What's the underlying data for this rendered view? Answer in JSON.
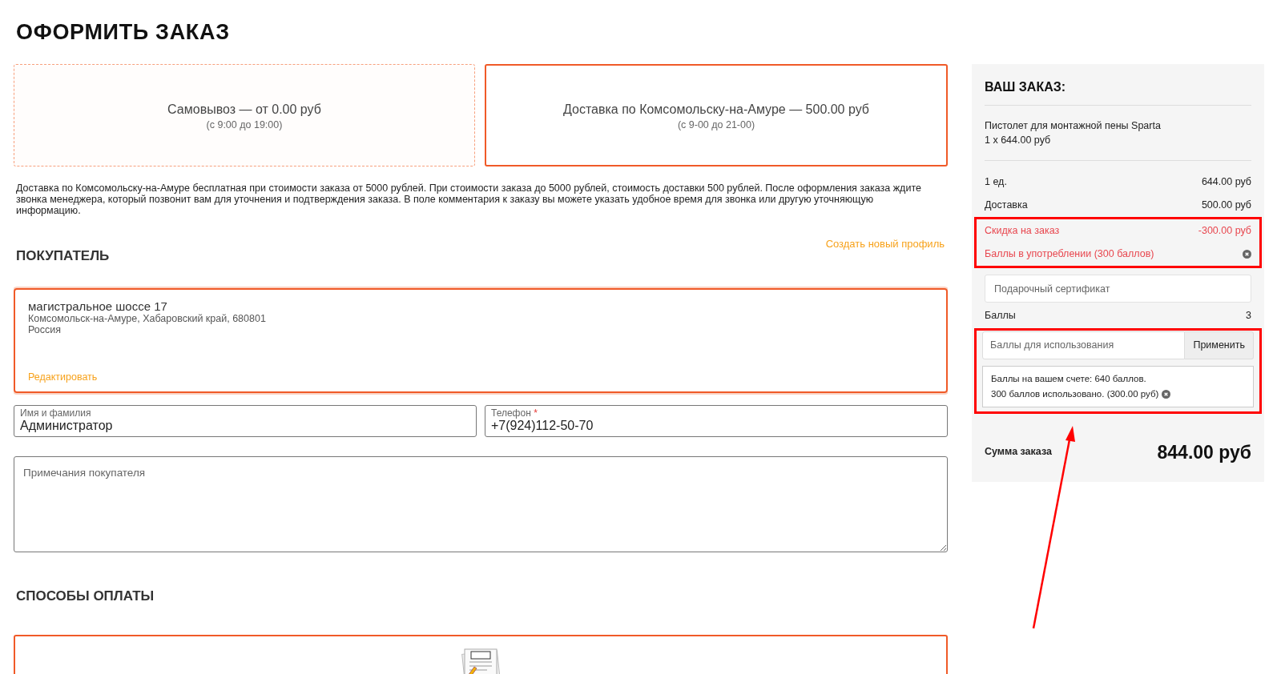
{
  "page_title": "ОФОРМИТЬ ЗАКАЗ",
  "delivery_options": [
    {
      "title": "Самовывоз — от 0.00 руб",
      "hours": "(с 9:00 до 19:00)",
      "selected": false
    },
    {
      "title": "Доставка по Комсомольску-на-Амуре — 500.00 руб",
      "hours": "(с 9-00 до 21-00)",
      "selected": true
    }
  ],
  "delivery_note": "Доставка по Комсомольску-на-Амуре бесплатная при стоимости заказа от 5000 рублей. При стоимости заказа до 5000 рублей, стоимость доставки 500 рублей. После оформления заказа ждите звонка менеджера, который позвонит вам для уточнения и подтверждения заказа. В поле комментария к заказу вы можете указать удобное время для звонка или другую уточняющую информацию.",
  "buyer": {
    "create_profile_link": "Создать новый профиль",
    "heading": "ПОКУПАТЕЛЬ",
    "address": {
      "street": "магистральное шоссе 17",
      "city": "Комсомольск-на-Амуре, Хабаровский край, 680801",
      "country": "Россия",
      "edit_link": "Редактировать",
      "selected": true
    },
    "fields": [
      {
        "label": "Имя и фамилия",
        "value": "Администратор"
      },
      {
        "label": "Телефон",
        "required_mark": "*",
        "value": "+7(924)112-50-70"
      }
    ],
    "notes_placeholder": "Примечания покупателя"
  },
  "payment": {
    "heading": "СПОСОБЫ ОПЛАТЫ",
    "options": [
      {
        "selected": true
      }
    ]
  },
  "order": {
    "heading": "ВАШ ЗАКАЗ:",
    "product": {
      "name": "Пистолет для монтажной пены Sparta",
      "qty_price": "1 x 644.00 руб"
    },
    "lines": [
      {
        "kind": "normal",
        "label": "1 ед.",
        "value": "644.00 руб"
      },
      {
        "kind": "normal",
        "label": "Доставка",
        "value": "500.00 руб"
      },
      {
        "kind": "discount",
        "label": "Скидка на заказ",
        "value": "-300.00 руб"
      },
      {
        "kind": "points",
        "label": "Баллы в употреблении (300 баллов)",
        "removable": true
      }
    ],
    "certificate_placeholder": "Подарочный сертификат",
    "points": {
      "label": "Баллы",
      "value": "3"
    },
    "points_input_placeholder": "Баллы для использования",
    "apply_button": "Применить",
    "points_info": [
      {
        "text": "Баллы на вашем счете: 640 баллов.",
        "removable": false
      },
      {
        "text": "300 баллов использовано. (300.00 руб)",
        "removable": true
      }
    ],
    "total_label": "Сумма заказа",
    "total_value": "844.00 руб"
  }
}
